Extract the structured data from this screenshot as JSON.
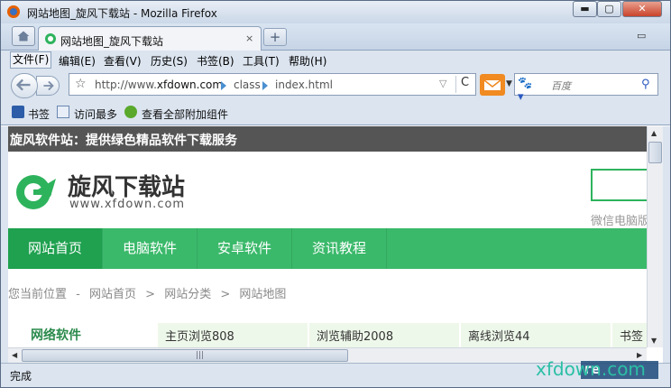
{
  "window": {
    "title": "网站地图_旋风下载站 - Mozilla Firefox",
    "min_label": "▬",
    "max_label": "▢",
    "close_label": "✕"
  },
  "tabs": {
    "active_label": "网站地图_旋风下载站",
    "close_label": "×",
    "new_tab_label": "+",
    "list_label": "▭"
  },
  "menu": {
    "items": [
      "文件(F)",
      "编辑(E)",
      "查看(V)",
      "历史(S)",
      "书签(B)",
      "工具(T)",
      "帮助(H)"
    ]
  },
  "navbar": {
    "url_host_prefix": "http://www.",
    "url_host_domain": "xfdown.com",
    "url_seg1": "class",
    "url_seg2": "index.html",
    "search_placeholder": "百度",
    "dropdown_glyph": "▽",
    "reload_glyph": "C"
  },
  "bookmarks": {
    "items": [
      "书签",
      "访问最多",
      "查看全部附加组件"
    ]
  },
  "page": {
    "topbar_text": "旋风软件站：提供绿色精品软件下载服务",
    "logo_text": "旋风下载站",
    "logo_sub": "www.xfdown.com",
    "side_text": "微信电脑版",
    "nav": [
      "网站首页",
      "电脑软件",
      "安卓软件",
      "资讯教程"
    ],
    "breadcrumb": [
      "您当前位置",
      "网站首页",
      "网站分类",
      "网站地图"
    ],
    "breadcrumb_sep": ">",
    "breadcrumb_first_sep": "-",
    "category": "网络软件",
    "cells": [
      "主页浏览808",
      "浏览辅助2008",
      "离线浏览44",
      "书签"
    ]
  },
  "status": {
    "text": "完成"
  },
  "watermark": {
    "text": "xfdown.com",
    "badge": "re"
  },
  "colors": {
    "accent_green": "#3ab96a",
    "active_nav": "#1fa14f",
    "topbar": "#555555"
  }
}
